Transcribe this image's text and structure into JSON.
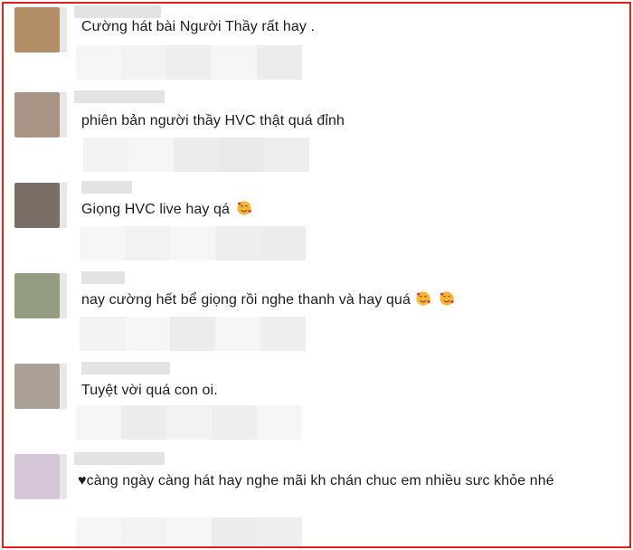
{
  "comments": [
    {
      "text": "Cường hát bài Người Thầy rất hay .",
      "avatar_color": "#b38e66"
    },
    {
      "text": "phiên bản người thầy HVC thật quá đỉnh",
      "avatar_color": "#a89384"
    },
    {
      "text": "Giọng HVC live hay qá",
      "avatar_color": "#7a6e66",
      "emoji": "smiling-face-with-hearts"
    },
    {
      "text": "nay cường hết bể giọng rồi nghe thanh và hay quá",
      "avatar_color": "#949c82",
      "emoji": "smiling-face-with-hearts x2"
    },
    {
      "text": "Tuyệt vời quá con oi.",
      "avatar_color": "#aaa095"
    },
    {
      "text": "♥càng ngày càng hát hay nghe mãi kh chán chuc em nhiều sưc khỏe nhé",
      "avatar_color": "#d4c6d6"
    }
  ],
  "colors": {
    "frame_border": "#e0211f",
    "text": "#1c1e21",
    "blur": "#ececec"
  }
}
